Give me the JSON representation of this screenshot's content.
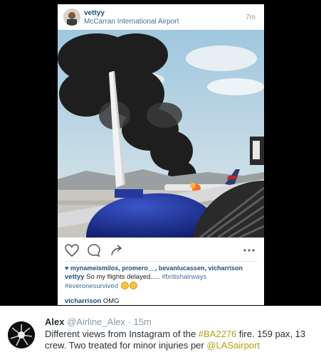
{
  "instagram": {
    "username": "vettyy",
    "location": "McCarran International Airport",
    "time": "7m",
    "likes": "mynameismilos, promero__, bevanlucassen, vicharrison",
    "caption": {
      "user": "vettyy",
      "text": " So my flights delayed..... ",
      "hashtag1": "#britishairways",
      "hashtag2": "#everonesurvived"
    },
    "comment": {
      "user": "vicharrison",
      "text": " OMG"
    },
    "icons": [
      "heart-icon",
      "comment-icon",
      "share-icon",
      "more-icon"
    ]
  },
  "tweet": {
    "name": "Alex",
    "handle": "@Airline_Alex",
    "time": "· 15m",
    "text_part1": "Different views from Instagram of the ",
    "hashtag": "#BA2276",
    "text_part2": " fire. 159 pax, 13 crew. Two treated for minor injuries per ",
    "mention": "@LASairport",
    "link_color": "#b3a014"
  }
}
